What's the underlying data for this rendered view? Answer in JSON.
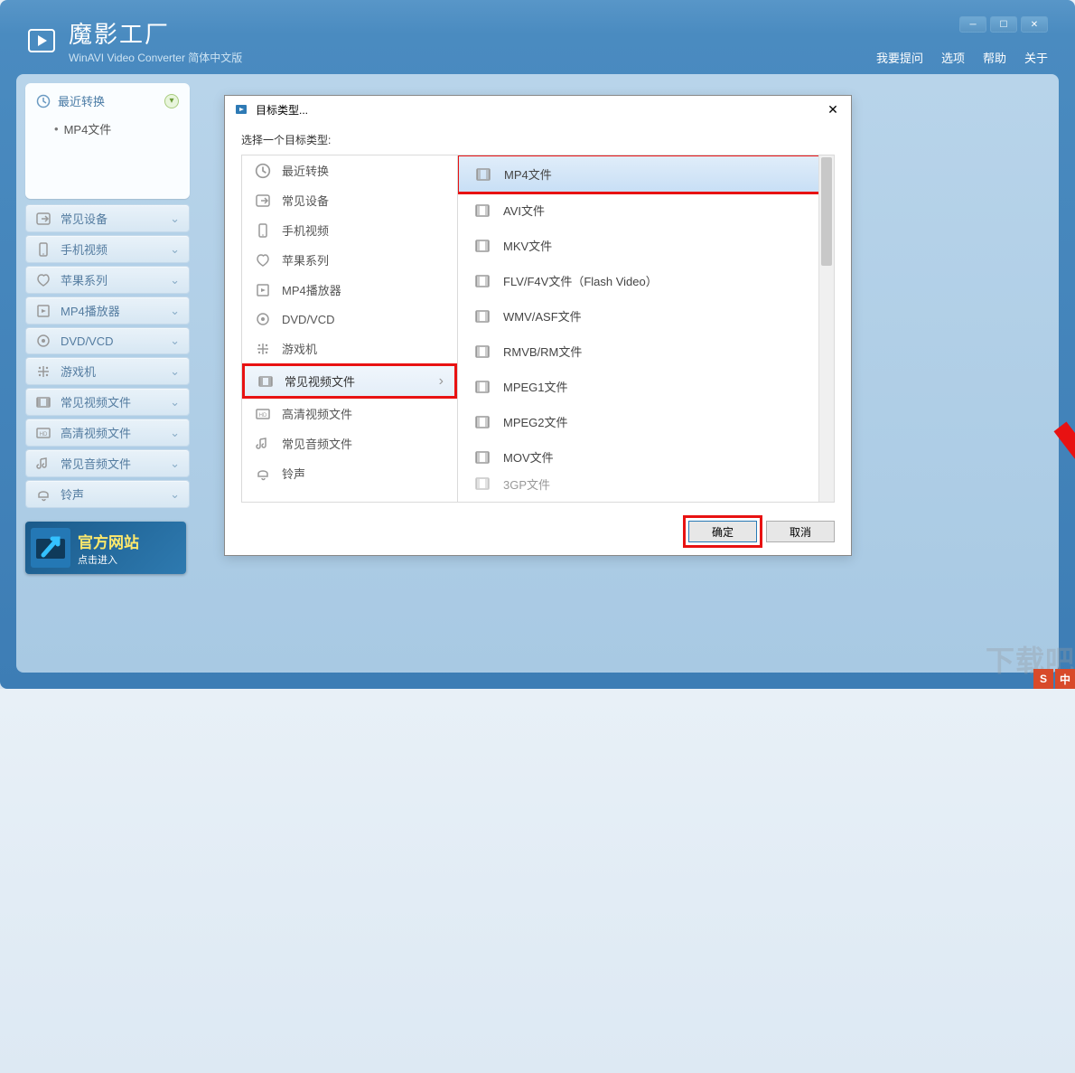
{
  "app": {
    "title": "魔影工厂",
    "subtitle": "WinAVI Video Converter 简体中文版"
  },
  "header_menu": {
    "feedback": "我要提问",
    "options": "选项",
    "help": "帮助",
    "about": "关于"
  },
  "sidebar": {
    "recent": {
      "label": "最近转换",
      "sub": "MP4文件"
    },
    "items": [
      "常见设备",
      "手机视频",
      "苹果系列",
      "MP4播放器",
      "DVD/VCD",
      "游戏机",
      "常见视频文件",
      "高清视频文件",
      "常见音频文件",
      "铃声"
    ]
  },
  "promo": {
    "title": "官方网站",
    "subtitle": "点击进入"
  },
  "dialog": {
    "title": "目标类型...",
    "prompt": "选择一个目标类型:",
    "categories": [
      "最近转换",
      "常见设备",
      "手机视频",
      "苹果系列",
      "MP4播放器",
      "DVD/VCD",
      "游戏机",
      "常见视频文件",
      "高清视频文件",
      "常见音频文件",
      "铃声"
    ],
    "selected_category_index": 7,
    "formats": [
      "MP4文件",
      "AVI文件",
      "MKV文件",
      "FLV/F4V文件（Flash Video）",
      "WMV/ASF文件",
      "RMVB/RM文件",
      "MPEG1文件",
      "MPEG2文件",
      "MOV文件",
      "3GP文件"
    ],
    "selected_format_index": 0,
    "ok": "确定",
    "cancel": "取消"
  },
  "corner": [
    "S",
    "中"
  ]
}
